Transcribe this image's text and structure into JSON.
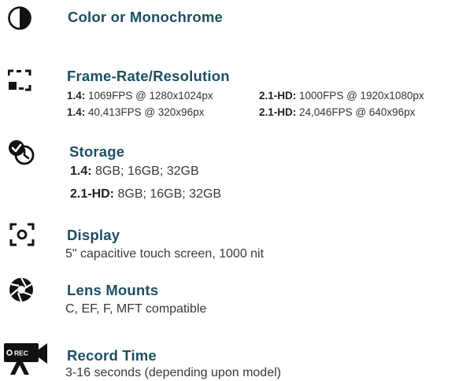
{
  "features": {
    "color": {
      "title": "Color or Monochrome",
      "icon": "half-circle-icon"
    },
    "framerate": {
      "title": "Frame-Rate/Resolution",
      "icon": "aspect-frame-icon",
      "specs": [
        {
          "model": "1.4:",
          "value": "1069FPS @ 1280x1024px"
        },
        {
          "model": "2.1-HD:",
          "value": "1000FPS @ 1920x1080px"
        },
        {
          "model": "1.4:",
          "value": "40,413FPS @ 320x96px"
        },
        {
          "model": "2.1-HD:",
          "value": "24,046FPS @ 640x96px"
        }
      ]
    },
    "storage": {
      "title": "Storage",
      "icon": "storage-clock-icon",
      "specs": [
        {
          "model": "1.4:",
          "value": "8GB; 16GB; 32GB"
        },
        {
          "model": "2.1-HD:",
          "value": "8GB; 16GB; 32GB"
        }
      ]
    },
    "display": {
      "title": "Display",
      "icon": "camera-viewfinder-icon",
      "description": "5\" capacitive touch screen, 1000 nit"
    },
    "lens": {
      "title": "Lens Mounts",
      "icon": "aperture-icon",
      "description": "C, EF, F, MFT compatible"
    },
    "record": {
      "title": "Record Time",
      "icon": "record-camera-icon",
      "icon_text": "REC",
      "description": "3-16 seconds (depending upon model)"
    }
  },
  "colors": {
    "title": "#1d4f63",
    "icon": "#111111"
  }
}
